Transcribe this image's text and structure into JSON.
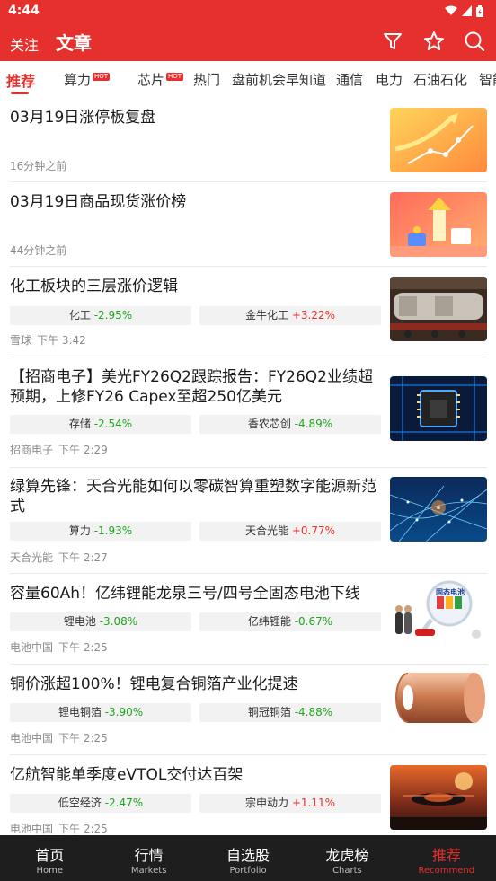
{
  "status": {
    "time": "4:44"
  },
  "appbar": {
    "follow": "关注",
    "title": "文章",
    "icons": [
      "filter-icon",
      "star-icon",
      "search-icon"
    ]
  },
  "tabs": [
    {
      "label": "推荐",
      "active": true,
      "hot": false
    },
    {
      "label": "算力",
      "hot": true
    },
    {
      "label": "芯片",
      "hot": true
    },
    {
      "label": "热门",
      "hot": false
    },
    {
      "label": "盘前机会早知道",
      "hot": false
    },
    {
      "label": "通信",
      "hot": false
    },
    {
      "label": "电力",
      "hot": false
    },
    {
      "label": "石油石化",
      "hot": false
    },
    {
      "label": "智能",
      "hot": false
    }
  ],
  "hot_badge": "HOT",
  "articles": [
    {
      "title": "03月19日涨停板复盘",
      "source": "",
      "time": "16分钟之前",
      "chips": []
    },
    {
      "title": "03月19日商品现货涨价榜",
      "source": "",
      "time": "44分钟之前",
      "chips": []
    },
    {
      "title": "化工板块的三层涨价逻辑",
      "source": "雪球",
      "time": "下午 3:42",
      "chips": [
        {
          "name": "化工",
          "change": "-2.95%",
          "dir": "down"
        },
        {
          "name": "金牛化工",
          "change": "+3.22%",
          "dir": "up"
        }
      ]
    },
    {
      "title": "【招商电子】美光FY26Q2跟踪报告：FY26Q2业绩超预期，上修FY26 Capex至超250亿美元",
      "source": "招商电子",
      "time": "下午 2:29",
      "chips": [
        {
          "name": "存储",
          "change": "-2.54%",
          "dir": "down"
        },
        {
          "name": "香农芯创",
          "change": "-4.89%",
          "dir": "down"
        }
      ]
    },
    {
      "title": "绿算先锋：天合光能如何以零碳智算重塑数字能源新范式",
      "source": "天合光能",
      "time": "下午 2:27",
      "chips": [
        {
          "name": "算力",
          "change": "-1.93%",
          "dir": "down"
        },
        {
          "name": "天合光能",
          "change": "+0.77%",
          "dir": "up"
        }
      ]
    },
    {
      "title": "容量60Ah！亿纬锂能龙泉三号/四号全固态电池下线",
      "source": "电池中国",
      "time": "下午 2:25",
      "chips": [
        {
          "name": "锂电池",
          "change": "-3.08%",
          "dir": "down"
        },
        {
          "name": "亿纬锂能",
          "change": "-0.67%",
          "dir": "down"
        }
      ],
      "thumb_text": "固态电池"
    },
    {
      "title": "铜价涨超100%！锂电复合铜箔产业化提速",
      "source": "电池中国",
      "time": "下午 2:25",
      "chips": [
        {
          "name": "锂电铜箔",
          "change": "-3.90%",
          "dir": "down"
        },
        {
          "name": "铜冠铜箔",
          "change": "-4.88%",
          "dir": "down"
        }
      ]
    },
    {
      "title": "亿航智能单季度eVTOL交付达百架",
      "source": "电池中国",
      "time": "下午 2:25",
      "chips": [
        {
          "name": "低空经济",
          "change": "-2.47%",
          "dir": "down"
        },
        {
          "name": "宗申动力",
          "change": "+1.11%",
          "dir": "up"
        }
      ]
    }
  ],
  "bottom_nav": [
    {
      "zh": "首页",
      "en": "Home",
      "active": false
    },
    {
      "zh": "行情",
      "en": "Markets",
      "active": false
    },
    {
      "zh": "自选股",
      "en": "Portfolio",
      "active": false
    },
    {
      "zh": "龙虎榜",
      "en": "Charts",
      "active": false
    },
    {
      "zh": "推荐",
      "en": "Recommend",
      "active": true
    }
  ],
  "colors": {
    "brand": "#e5302e",
    "down": "#1ea41e",
    "up": "#e5302e"
  }
}
